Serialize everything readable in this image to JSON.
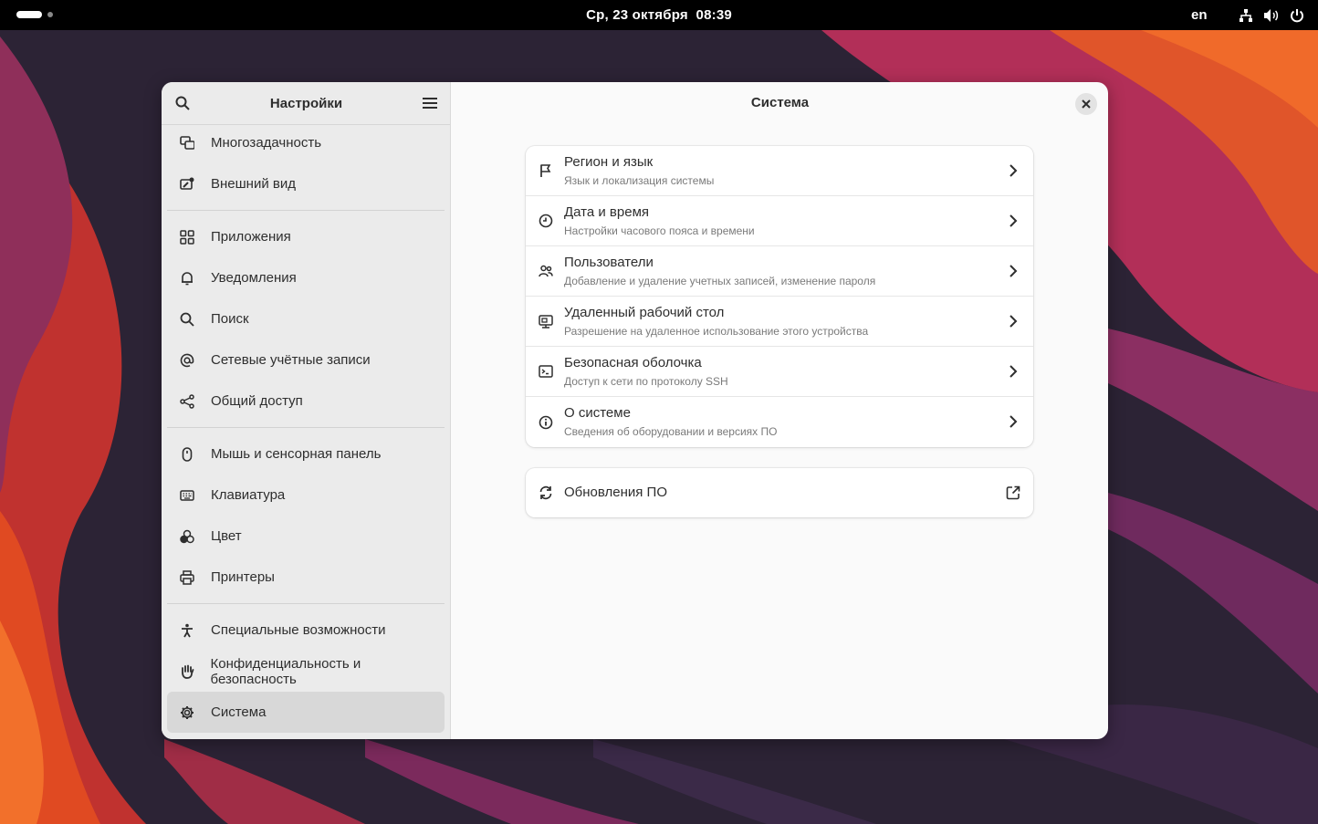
{
  "topbar": {
    "clock": "Ср, 23 октября  08:39",
    "language": "en",
    "tray_icons": [
      "network-icon",
      "volume-icon",
      "power-icon"
    ]
  },
  "window": {
    "sidebar_title": "Настройки",
    "content_title": "Система"
  },
  "sidebar": {
    "groups": [
      [
        {
          "label": "Многозадачность",
          "icon": "multitasking-icon"
        },
        {
          "label": "Внешний вид",
          "icon": "appearance-icon"
        }
      ],
      [
        {
          "label": "Приложения",
          "icon": "apps-icon"
        },
        {
          "label": "Уведомления",
          "icon": "bell-icon"
        },
        {
          "label": "Поиск",
          "icon": "search-icon"
        },
        {
          "label": "Сетевые учётные записи",
          "icon": "at-icon"
        },
        {
          "label": "Общий доступ",
          "icon": "share-icon"
        }
      ],
      [
        {
          "label": "Мышь и сенсорная панель",
          "icon": "mouse-icon"
        },
        {
          "label": "Клавиатура",
          "icon": "keyboard-icon"
        },
        {
          "label": "Цвет",
          "icon": "color-icon"
        },
        {
          "label": "Принтеры",
          "icon": "printer-icon"
        }
      ],
      [
        {
          "label": "Специальные возможности",
          "icon": "accessibility-icon"
        },
        {
          "label": "Конфиденциальность и безопасность",
          "icon": "hand-icon"
        },
        {
          "label": "Система",
          "icon": "gear-icon",
          "active": true
        }
      ]
    ]
  },
  "system": {
    "rows": [
      {
        "title": "Регион и язык",
        "subtitle": "Язык и локализация системы",
        "icon": "flag-icon"
      },
      {
        "title": "Дата и время",
        "subtitle": "Настройки часового пояса и времени",
        "icon": "clock-icon"
      },
      {
        "title": "Пользователи",
        "subtitle": "Добавление и удаление учетных записей, изменение пароля",
        "icon": "users-icon"
      },
      {
        "title": "Удаленный рабочий стол",
        "subtitle": "Разрешение на удаленное использование этого устройства",
        "icon": "remote-desktop-icon"
      },
      {
        "title": "Безопасная оболочка",
        "subtitle": "Доступ к сети по протоколу SSH",
        "icon": "terminal-icon"
      },
      {
        "title": "О системе",
        "subtitle": "Сведения об оборудовании и версиях ПО",
        "icon": "info-icon"
      }
    ],
    "updates": {
      "title": "Обновления ПО",
      "icon": "refresh-icon"
    }
  }
}
